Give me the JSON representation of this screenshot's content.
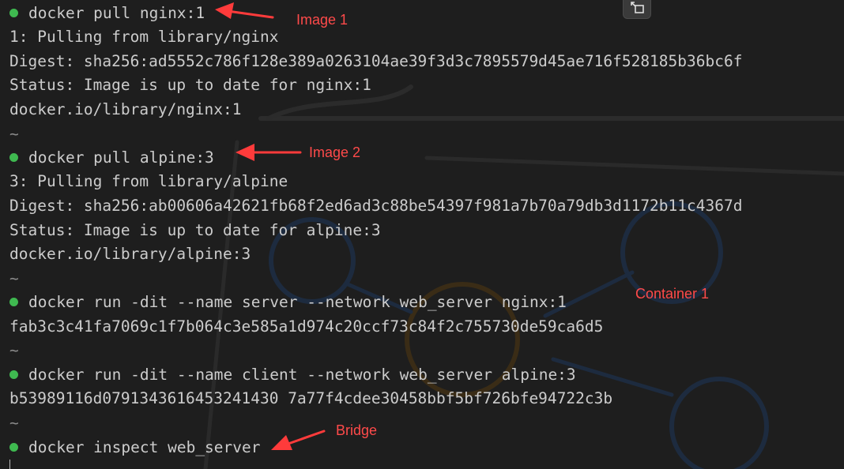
{
  "terminal": {
    "lines": [
      {
        "kind": "command",
        "text": "docker pull nginx:1"
      },
      {
        "kind": "output",
        "text": "1: Pulling from library/nginx"
      },
      {
        "kind": "output",
        "text": "Digest: sha256:ad5552c786f128e389a0263104ae39f3d3c7895579d45ae716f528185b36bc6f"
      },
      {
        "kind": "output",
        "text": "Status: Image is up to date for nginx:1"
      },
      {
        "kind": "output",
        "text": "docker.io/library/nginx:1"
      },
      {
        "kind": "tilde",
        "text": "~"
      },
      {
        "kind": "command",
        "text": "docker pull alpine:3"
      },
      {
        "kind": "output",
        "text": "3: Pulling from library/alpine"
      },
      {
        "kind": "output",
        "text": "Digest: sha256:ab00606a42621fb68f2ed6ad3c88be54397f981a7b70a79db3d1172b11c4367d"
      },
      {
        "kind": "output",
        "text": "Status: Image is up to date for alpine:3"
      },
      {
        "kind": "output",
        "text": "docker.io/library/alpine:3"
      },
      {
        "kind": "tilde",
        "text": "~"
      },
      {
        "kind": "command",
        "text": "docker run -dit --name server --network web_server nginx:1"
      },
      {
        "kind": "output",
        "text": "fab3c3c41fa7069c1f7b064c3e585a1d974c20ccf73c84f2c755730de59ca6d5"
      },
      {
        "kind": "tilde",
        "text": "~"
      },
      {
        "kind": "command",
        "text": "docker run -dit --name client --network web_server alpine:3"
      },
      {
        "kind": "output",
        "text": "b53989116d0791343616453241430 7a77f4cdee30458bbf5bf726bfe94722c3b"
      },
      {
        "kind": "tilde",
        "text": "~"
      },
      {
        "kind": "command",
        "text": "docker inspect web_server"
      }
    ]
  },
  "annotations": {
    "image1": "Image 1",
    "image2": "Image 2",
    "container1": "Container 1",
    "bridge": "Bridge"
  },
  "colors": {
    "background": "#1e1e1e",
    "text": "#cccccc",
    "prompt_dot": "#3fb950",
    "annotation": "#ff4a4a"
  },
  "icons": {
    "corner_button": "restore-window-icon"
  }
}
